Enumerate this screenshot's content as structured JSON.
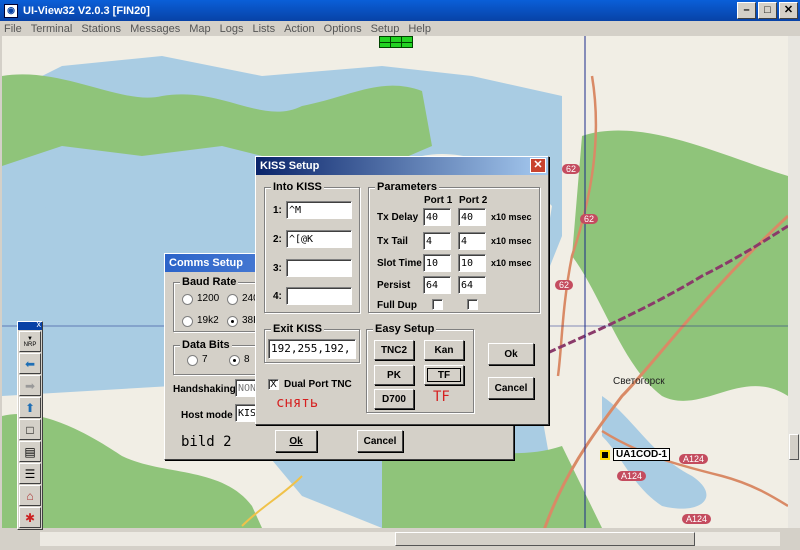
{
  "app": {
    "title": "UI-View32 V2.0.3 [FIN20]"
  },
  "menu": [
    "File",
    "Terminal",
    "Stations",
    "Messages",
    "Map",
    "Logs",
    "Lists",
    "Action",
    "Options",
    "Setup",
    "Help"
  ],
  "map": {
    "station_label": "UA1COD-1",
    "city_label": "Светогорск",
    "road_labels": [
      "62",
      "62",
      "62",
      "A124",
      "A124",
      "A124"
    ]
  },
  "toolbar_panel": {
    "nrp_label": "NRP",
    "close": "x"
  },
  "comms_setup": {
    "title": "Comms Setup",
    "baud_rate_title": "Baud Rate",
    "baud_options": [
      "1200",
      "240",
      "19k2",
      "38K"
    ],
    "data_bits_title": "Data Bits",
    "data_bits_options": [
      "7",
      "8"
    ],
    "handshaking_label": "Handshaking",
    "handshaking_value": "NON",
    "host_mode_label": "Host mode",
    "host_mode_value": "KIS",
    "ok": "Ok",
    "cancel": "Cancel",
    "annotation": "bild 2"
  },
  "kiss_setup": {
    "title": "KISS Setup",
    "into_kiss_title": "Into KISS",
    "into_kiss": [
      {
        "label": "1:",
        "value": "^M"
      },
      {
        "label": "2:",
        "value": "^[@K"
      },
      {
        "label": "3:",
        "value": ""
      },
      {
        "label": "4:",
        "value": ""
      }
    ],
    "exit_kiss_title": "Exit KISS",
    "exit_kiss_value": "192,255,192,",
    "dual_port_label": "Dual Port TNC",
    "dual_port_checked": "X",
    "annotation_ru": "снять",
    "params_title": "Parameters",
    "port1_header": "Port 1",
    "port2_header": "Port 2",
    "params": [
      {
        "label": "Tx Delay",
        "p1": "40",
        "p2": "40",
        "unit": "x10 msec"
      },
      {
        "label": "Tx Tail",
        "p1": "4",
        "p2": "4",
        "unit": "x10 msec"
      },
      {
        "label": "Slot Time",
        "p1": "10",
        "p2": "10",
        "unit": "x10 msec"
      },
      {
        "label": "Persist",
        "p1": "64",
        "p2": "64",
        "unit": ""
      }
    ],
    "full_dup_label": "Full Dup",
    "easy_setup_title": "Easy Setup",
    "easy_buttons": [
      "TNC2",
      "Kan",
      "PK",
      "TF",
      "D700"
    ],
    "tf_annotation": "TF",
    "ok": "Ok",
    "cancel": "Cancel"
  },
  "colors": {
    "title_blue": "#0842a6",
    "annotation_red": "#d62020",
    "map_water": "#a9cce3",
    "map_forest": "#8fc47a"
  }
}
